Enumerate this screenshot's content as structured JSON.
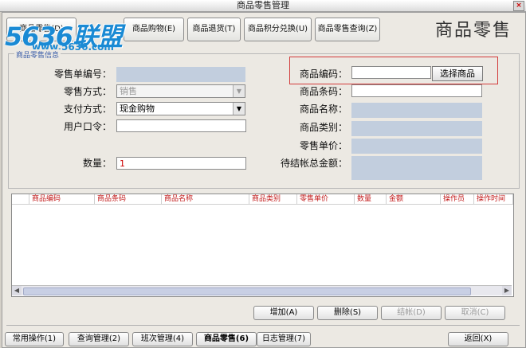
{
  "window": {
    "title": "商品零售管理",
    "close": "×"
  },
  "logo": {
    "brand": "5636联盟",
    "url": "www.5636.com"
  },
  "page_heading": "商品零售",
  "toolbar": [
    {
      "label": "商品零售(D)"
    },
    {
      "label": "商品购物(E)"
    },
    {
      "label": "商品退货(T)"
    },
    {
      "label": "商品积分兑换(U)"
    },
    {
      "label": "商品零售查询(Z)"
    }
  ],
  "group_title": "商品零售信息",
  "form": {
    "sale_no_label": "零售单编号：",
    "sale_mode_label": "零售方式：",
    "sale_mode_value": "销售",
    "pay_mode_label": "支付方式：",
    "pay_mode_value": "现金购物",
    "user_pwd_label": "用户口令：",
    "qty_label": "数量：",
    "qty_value": "1",
    "code_label": "商品编码：",
    "pick_button": "选择商品",
    "barcode_label": "商品条码：",
    "name_label": "商品名称：",
    "category_label": "商品类别：",
    "price_label": "零售单价：",
    "total_label": "待结帐总金额："
  },
  "grid": {
    "columns": [
      "商品编码",
      "商品条码",
      "商品名称",
      "商品类别",
      "零售单价",
      "数量",
      "金额",
      "操作员",
      "操作时间"
    ]
  },
  "actions": {
    "add": "增加(A)",
    "delete": "删除(S)",
    "checkout": "结帐(D)",
    "cancel": "取消(C)"
  },
  "nav": {
    "common": "常用操作(1)",
    "query": "查询管理(2)",
    "shift": "班次管理(4)",
    "retail": "商品零售(6)",
    "log": "日志管理(7)",
    "back": "返回(X)"
  },
  "colors": {
    "readonly": "#c2cede",
    "highlight": "#d23a3a",
    "header_text": "#c21a1a",
    "logo": "#1a8ad4"
  }
}
